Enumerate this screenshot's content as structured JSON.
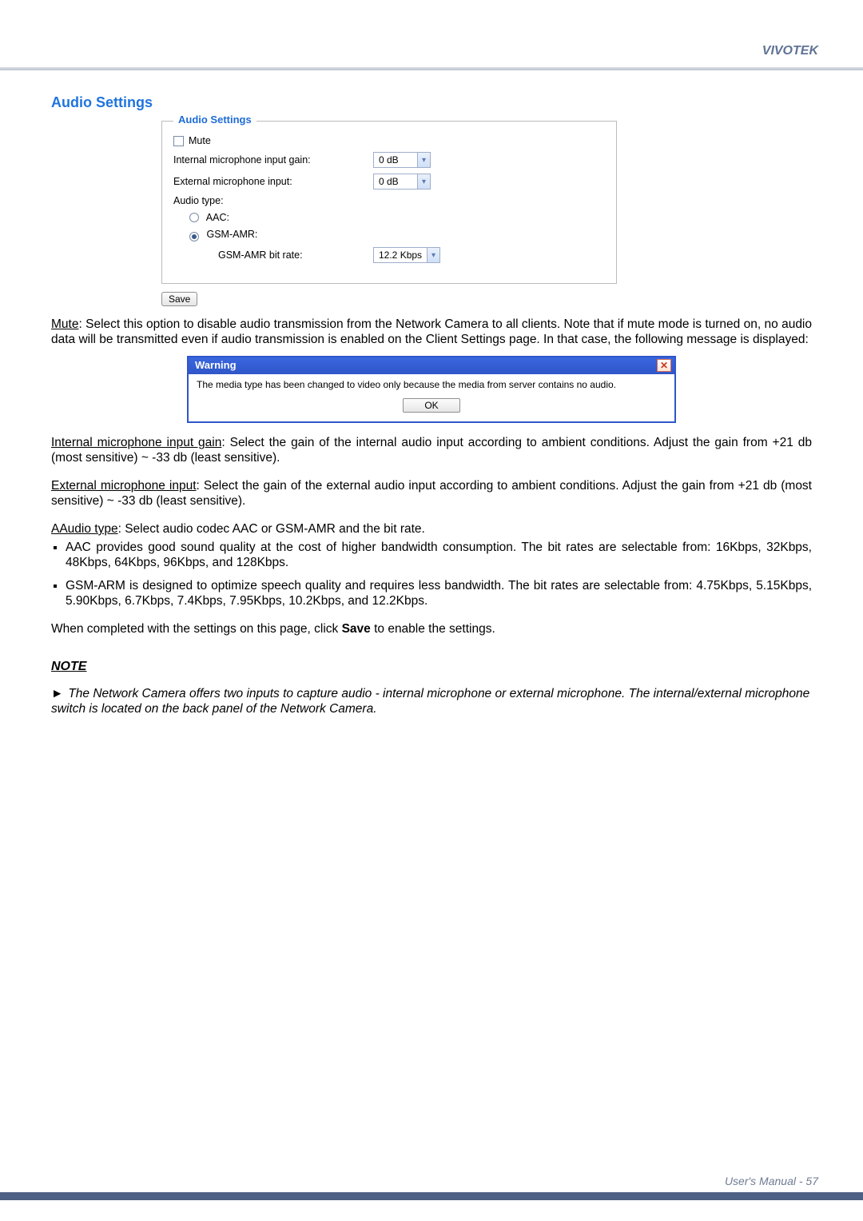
{
  "brand": "VIVOTEK",
  "section_title": "Audio Settings",
  "fieldset_legend": "Audio Settings",
  "form": {
    "mute_label": "Mute",
    "internal_gain_label": "Internal microphone input gain:",
    "internal_gain_value": "0 dB",
    "external_gain_label": "External microphone input:",
    "external_gain_value": "0 dB",
    "audio_type_label": "Audio type:",
    "aac_label": "AAC:",
    "gsmamr_label": "GSM-AMR:",
    "gsmamr_bitrate_label": "GSM-AMR bit rate:",
    "gsmamr_bitrate_value": "12.2 Kbps",
    "save_label": "Save"
  },
  "desc": {
    "mute_term": "Mute",
    "mute_text": ": Select this option to disable audio transmission from the Network Camera to all clients. Note that if mute mode is turned on, no audio data will be transmitted even if audio transmission is enabled on the Client Settings page. In that case, the following message is displayed:",
    "warning_title": "Warning",
    "warning_msg": "The media type has been changed to video only because the media from server contains no audio.",
    "warning_ok": "OK",
    "int_gain_term": "Internal microphone input gain",
    "int_gain_text": ": Select the gain of the internal audio input according to ambient conditions. Adjust the gain from +21 db (most sensitive) ~ -33 db (least sensitive).",
    "ext_gain_term": "External microphone input",
    "ext_gain_text": ": Select the gain of the external audio input according to ambient conditions. Adjust the gain from +21 db (most sensitive) ~ -33 db (least sensitive).",
    "audio_type_term": "AAudio type",
    "audio_type_text": ": Select audio codec AAC or GSM-AMR and the bit rate.",
    "aac_bullet": "AAC provides good sound quality at the cost of higher bandwidth consumption. The bit rates are selectable from: 16Kbps, 32Kbps, 48Kbps, 64Kbps, 96Kbps, and 128Kbps.",
    "gsm_bullet": "GSM-ARM is designed to optimize speech quality and requires less bandwidth. The bit rates are selectable from: 4.75Kbps, 5.15Kbps, 5.90Kbps, 6.7Kbps, 7.4Kbps, 7.95Kbps, 10.2Kbps, and 12.2Kbps.",
    "save_para_pre": "When completed with the settings on this page, click ",
    "save_para_bold": "Save",
    "save_para_post": " to enable the settings."
  },
  "note": {
    "heading": "NOTE",
    "body": "The Network Camera offers two inputs to capture audio - internal microphone or external microphone. The internal/external microphone switch is located on the back panel of the Network Camera."
  },
  "footer": {
    "label": "User's Manual - ",
    "page": "57"
  }
}
